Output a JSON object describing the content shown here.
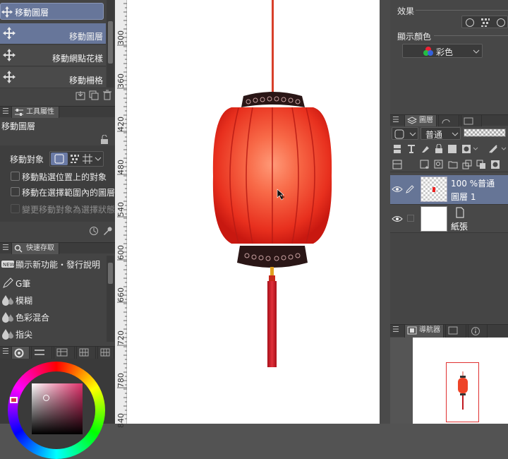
{
  "sub_tool": {
    "top_selected": "移動圖層",
    "items": [
      "移動圖層",
      "移動網點花樣",
      "移動柵格"
    ]
  },
  "tool_property": {
    "tab": "工具屬性",
    "title": "移動圖層",
    "target_label": "移動對象",
    "options": [
      "移動點選位置上的對象",
      "移動在選擇範圍內的圖層",
      "變更移動對象為選擇狀態"
    ]
  },
  "quick_access": {
    "tab": "快速存取",
    "items": [
      "顯示新功能・發行說明",
      "G筆",
      "模糊",
      "色彩混合",
      "指尖"
    ]
  },
  "ruler": {
    "labels": [
      "300",
      "360",
      "420",
      "480",
      "540",
      "600",
      "660",
      "720",
      "780",
      "840"
    ]
  },
  "color_panel": {
    "selected_hex": "#c86078"
  },
  "right_panel": {
    "effect_label": "效果",
    "display_color_label": "顯示顏色",
    "display_color_value": "彩色",
    "layers_tab": "圖層",
    "blend_mode": "普通",
    "layers": [
      {
        "opacity_mode": "100 %普通",
        "name": "圖層 1",
        "selected": true
      },
      {
        "opacity_mode": "",
        "name": "紙張",
        "selected": false
      }
    ],
    "navigator_tab": "導航器"
  }
}
